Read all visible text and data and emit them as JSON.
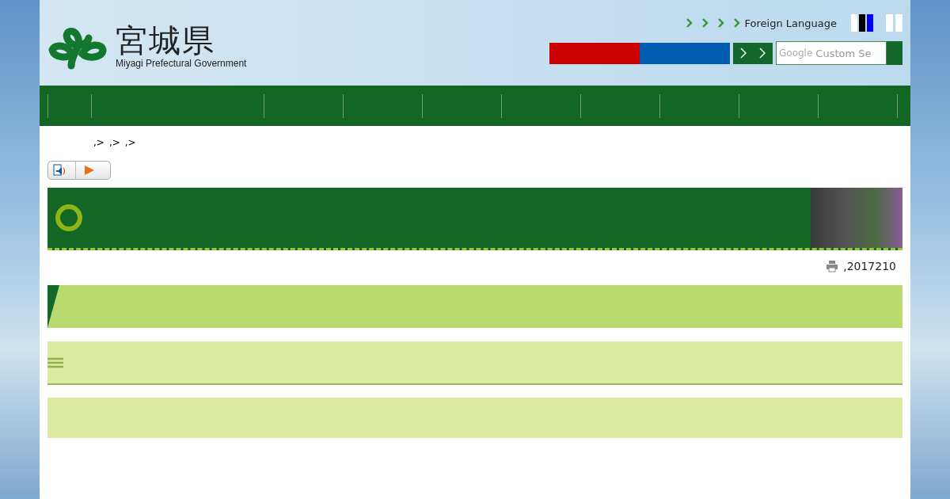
{
  "header": {
    "logo_text": "宮城県",
    "logo_subtitle": "Miyagi Prefectural Government",
    "links": [
      {
        "label": "Foreign Language"
      }
    ],
    "contrast_buttons": [
      {
        "color": "#ffffff"
      },
      {
        "color": "#000000"
      },
      {
        "color": "#0000ff"
      }
    ],
    "search": {
      "brand": "Google",
      "placeholder": "Custom Se"
    }
  },
  "breadcrumb": [
    ",>",
    ",>",
    ",>"
  ],
  "page": {
    "updated": ",2017210"
  }
}
